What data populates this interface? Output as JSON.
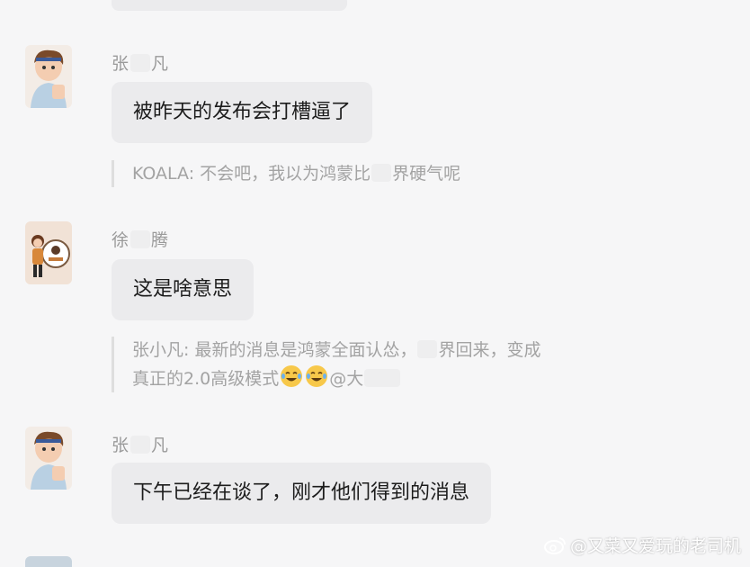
{
  "messages": [
    {
      "sender_prefix": "张",
      "sender_suffix": "凡",
      "text": "被昨天的发布会打槽逼了",
      "quote": {
        "prefix": "KOALA: 不会吧，我以为鸿蒙比",
        "suffix": "界硬气呢"
      }
    },
    {
      "sender_prefix": "徐",
      "sender_suffix": "腾",
      "text": "这是啥意思",
      "quote": {
        "line1_prefix": "张小凡: 最新的消息是鸿蒙全面认怂，",
        "line1_suffix": "界回来，变成",
        "line2_prefix": "真正的2.0高级模式",
        "line2_mention": "@大"
      }
    },
    {
      "sender_prefix": "张",
      "sender_suffix": "凡",
      "text": "下午已经在谈了，刚才他们得到的消息"
    }
  ],
  "watermark": "@又菜又爱玩的老司机",
  "icons": {
    "avatar1": "cartoon-boy-avatar",
    "avatar2": "cartoon-badge-avatar",
    "emoji": "laughing-tears-emoji",
    "watermark": "weibo-logo-icon"
  }
}
